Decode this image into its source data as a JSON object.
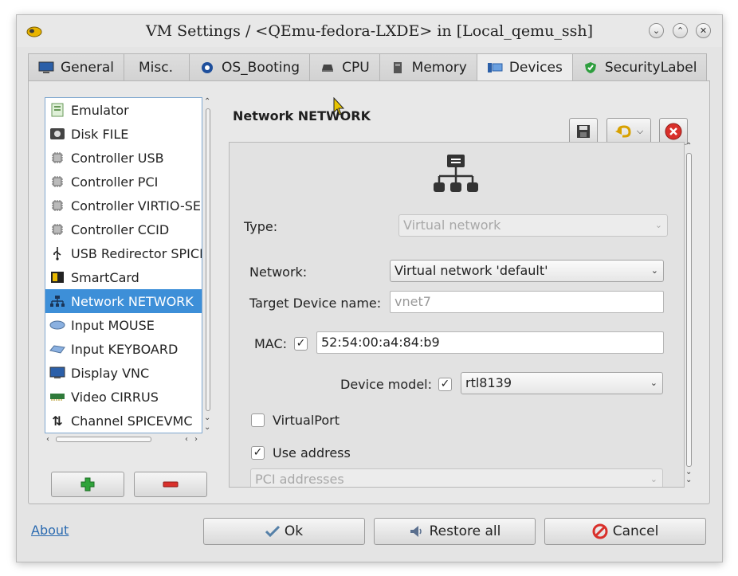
{
  "window": {
    "title": "VM Settings / <QEmu-fedora-LXDE> in [Local_qemu_ssh]",
    "controls": [
      "chevron-down-icon",
      "chevron-up-icon",
      "close-icon"
    ]
  },
  "tabs": [
    {
      "label": "General",
      "icon": "monitor-icon",
      "active": false
    },
    {
      "label": "Misc.",
      "icon": "",
      "active": false
    },
    {
      "label": "OS_Booting",
      "icon": "boot-icon",
      "active": false
    },
    {
      "label": "CPU",
      "icon": "cpu-icon",
      "active": false
    },
    {
      "label": "Memory",
      "icon": "memory-icon",
      "active": false
    },
    {
      "label": "Devices",
      "icon": "devices-icon",
      "active": true
    },
    {
      "label": "SecurityLabel",
      "icon": "shield-icon",
      "active": false
    }
  ],
  "devices": [
    {
      "label": "Emulator",
      "icon": "emulator-icon"
    },
    {
      "label": "Disk FILE",
      "icon": "disk-icon"
    },
    {
      "label": "Controller USB",
      "icon": "chip-icon"
    },
    {
      "label": "Controller PCI",
      "icon": "chip-icon"
    },
    {
      "label": "Controller VIRTIO-SE",
      "icon": "chip-icon"
    },
    {
      "label": "Controller CCID",
      "icon": "chip-icon"
    },
    {
      "label": "USB Redirector SPICE",
      "icon": "usb-icon"
    },
    {
      "label": "SmartCard",
      "icon": "smartcard-icon"
    },
    {
      "label": "Network NETWORK",
      "icon": "network-icon",
      "selected": true
    },
    {
      "label": "Input MOUSE",
      "icon": "mouse-icon"
    },
    {
      "label": "Input KEYBOARD",
      "icon": "keyboard-icon"
    },
    {
      "label": "Display VNC",
      "icon": "display-icon"
    },
    {
      "label": "Video CIRRUS",
      "icon": "video-icon"
    },
    {
      "label": "Channel SPICEVMC",
      "icon": "channel-icon"
    }
  ],
  "detail": {
    "title": "Network NETWORK",
    "type_label": "Type:",
    "type_value": "Virtual network",
    "network_label": "Network:",
    "network_value": "Virtual network 'default'",
    "target_label": "Target Device name:",
    "target_value": "vnet7",
    "mac_label": "MAC:",
    "mac_checked": true,
    "mac_value": "52:54:00:a4:84:b9",
    "model_label": "Device model:",
    "model_checked": true,
    "model_value": "rtl8139",
    "virtualport_label": "VirtualPort",
    "virtualport_checked": false,
    "use_address_label": "Use address",
    "use_address_checked": true,
    "address_value": "PCI addresses"
  },
  "buttons": {
    "about": "About",
    "ok": "Ok",
    "restore": "Restore all",
    "cancel": "Cancel"
  },
  "colors": {
    "selection": "#3d8fd8",
    "link": "#2a6ab0",
    "delete_red": "#d9302b",
    "add_green": "#2fa33a"
  }
}
